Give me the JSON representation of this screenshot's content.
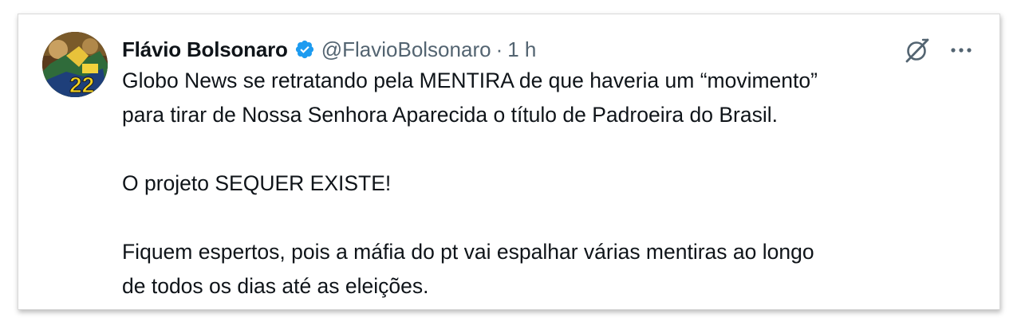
{
  "tweet": {
    "author": {
      "display_name": "Flávio Bolsonaro",
      "handle": "@FlavioBolsonaro",
      "separator": "·",
      "time": "1 h",
      "avatar_badge": "22",
      "verified": true
    },
    "paragraphs": [
      {
        "lines": [
          "Globo News se retratando pela MENTIRA de que haveria um “movimento”",
          "para tirar de Nossa Senhora Aparecida o título de Padroeira do Brasil."
        ]
      },
      {
        "lines": [
          "O projeto SEQUER EXISTE!"
        ]
      },
      {
        "lines": [
          "Fiquem espertos, pois a máfia do pt vai espalhar várias mentiras ao longo",
          "de todos os dias até as eleições."
        ]
      }
    ],
    "actions": {
      "grok_icon": "grok-icon",
      "more_icon": "more-icon"
    }
  },
  "colors": {
    "text_primary": "#0f1419",
    "text_secondary": "#536471",
    "verified_badge": "#1d9bf0"
  }
}
